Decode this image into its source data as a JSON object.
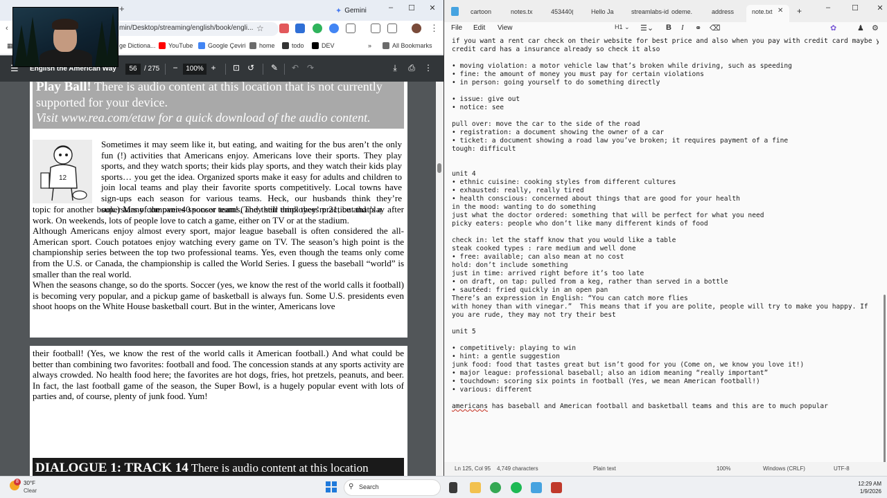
{
  "browser": {
    "active_tab": "Gemini",
    "address_text": "min/Desktop/streaming/english/book/engli...",
    "bookmarks": [
      "ge Dictiona...",
      "YouTube",
      "Google Çeviri",
      "home",
      "todo",
      "DEV",
      "All Bookmarks"
    ],
    "more_bookmarks": "»"
  },
  "pdf": {
    "title": "English the American Way",
    "page": "56",
    "total_pages": "/ 275",
    "zoom": "100%",
    "banner": {
      "heading": "Play Ball!",
      "line1": " There is audio content at this location that is not currently supported for your device.",
      "line2": "Visit www.rea.com/etaw for a quick download of the audio content."
    },
    "para1": "Sometimes it may seem like it, but eating, and waiting for the bus aren’t the only fun (!) activities that Americans enjoy. Americans love their sports. They play sports, and they watch sports; their kids play sports, and they watch their kids play sports… you get the idea. Organized sports make it easy for adults and children to join local teams and play their favorite sports competitively. Local towns have sign-ups each season for various teams. Heck, our husbands think they’re superstars of the over-40 soccer team! (They still think they’re 21, but that’s a",
    "para2": "topic for another book.) Many companies sponsor teams, and their employees practice and play after work. On weekends, lots of people love to catch a game, either on TV or at the stadium.\n   Although Americans enjoy almost every sport, major league baseball is often considered the all-American sport. Couch potatoes enjoy watching every game on TV. The season’s high point is the championship series between the top two professional teams. Yes, even though the teams only come from the U.S. or Canada, the championship is called the World Series. I guess the baseball “world” is smaller than the real world.\n   When the seasons change, so do the sports. Soccer (yes, we know the rest of the world calls it football) is becoming very popular, and a pickup game of basketball is always fun. Some U.S. presidents even shoot hoops on the White House basketball court. But in the winter, Americans love",
    "para3": "their football! (Yes, we know the rest of the world calls it American football.) And what could be better than combining two favorites: football and food. The concession stands at any sports activity are always crowded. No health food here; the favorites are hot dogs, fries, hot pretzels, peanuts, and beer. In fact, the last football game of the season, the Super Bowl, is a hugely popular event with lots of parties and, of course, plenty of junk food. Yum!",
    "dialogue_heading": "DIALOGUE 1: TRACK 14",
    "dialogue_rest": " There is audio content at this location"
  },
  "notepad": {
    "tabs": [
      "cartoon",
      "notes.tx",
      "453440(",
      "Hello Ja",
      "streamlabs-id",
      "odeme.",
      "address",
      "note.txt"
    ],
    "active_tab": "note.txt",
    "menu": [
      "File",
      "Edit",
      "View"
    ],
    "heading_style": "H1",
    "lines": [
      "if you want a rent car check on their website for best price and also when you pay with credit card maybe your",
      "credit card has a insurance already so check it also",
      "",
      "• moving violation: a motor vehicle law that’s broken while driving, such as speeding",
      "• fine: the amount of money you must pay for certain violations",
      "• in person: going yourself to do something directly",
      "",
      "• issue: give out",
      "• notice: see",
      "",
      "pull over: move the car to the side of the road",
      "• registration: a document showing the owner of a car",
      "• ticket: a document showing a road law you’ve broken; it requires payment of a fine",
      "tough: difficult",
      "",
      "",
      "unit 4",
      "• ethnic cuisine: cooking styles from different cultures",
      "• exhausted: really, really tired",
      "• health conscious: concerned about things that are good for your health",
      "in the mood: wanting to do something",
      "just what the doctor ordered: something that will be perfect for what you need",
      "picky eaters: people who don’t like many different kinds of food",
      "",
      "check in: let the staff know that you would like a table",
      "steak cooked types : rare medium and well done",
      "• free: available; can also mean at no cost",
      "hold: don’t include something",
      "just in time: arrived right before it’s too late",
      "• on draft, on tap: pulled from a keg, rather than served in a bottle",
      "• sautéed: fried quickly in an open pan",
      "There’s an expression in English: “You can catch more flies",
      "with honey than with vinegar.”  This means that if you are polite, people will try to make you happy. If",
      "you are rude, they may not try their best",
      "",
      "unit 5",
      "",
      "• competitively: playing to win",
      "• hint: a gentle suggestion",
      "junk food: food that tastes great but isn’t good for you (Come on, we know you love it!)",
      "• major league: professional baseball; also an idiom meaning “really important”",
      "• touchdown: scoring six points in football (Yes, we mean American football!)",
      "• various: different",
      ""
    ],
    "last_line_word": "americans",
    "last_line_rest": " has baseball and American football and basketball teams and this are to much popular",
    "status": {
      "position": "Ln 125, Col 95",
      "chars": "4,749 characters",
      "format": "Plain text",
      "zoom": "100%",
      "line_ending": "Windows (CRLF)",
      "encoding": "UTF-8"
    }
  },
  "taskbar": {
    "weather_badge": "8",
    "temperature": "30°F",
    "condition": "Clear",
    "search": "Search",
    "time": "12:29 AM",
    "date": "1/9/2026"
  },
  "colors": {
    "pdf_toolbar": "#323639",
    "pdf_background": "#525659",
    "banner_gray": "#a9a9a9",
    "notepad_bg": "#fafafa",
    "windows_blue": "#1f7adb"
  }
}
